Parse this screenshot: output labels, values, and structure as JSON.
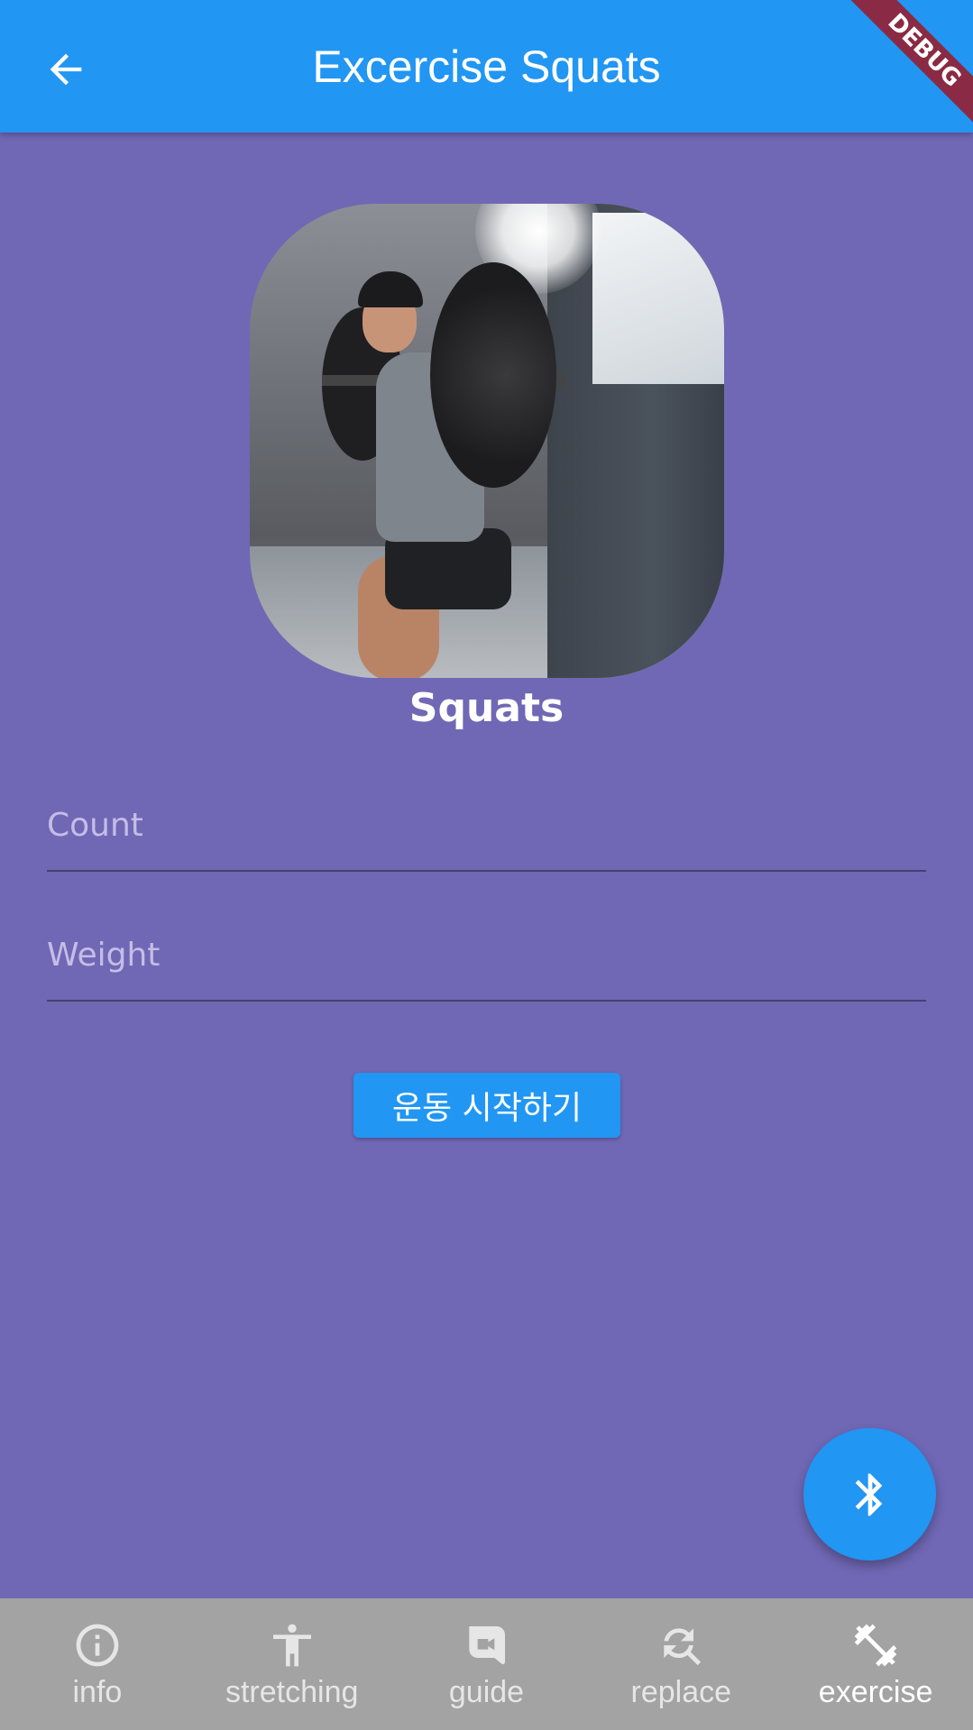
{
  "app_bar": {
    "title": "Excercise Squats",
    "back_icon": "arrow-left-icon",
    "background": "#2196f3"
  },
  "debug_banner": {
    "label": "DEBUG",
    "color": "#8a2a44"
  },
  "exercise": {
    "name": "Squats",
    "image_icon": "squat-photo"
  },
  "form": {
    "count_placeholder": "Count",
    "count_value": "",
    "weight_placeholder": "Weight",
    "weight_value": "",
    "start_label": "운동 시작하기"
  },
  "fab": {
    "icon": "bluetooth-icon",
    "color": "#2196f3"
  },
  "bottom_nav": {
    "selected": "exercise",
    "items": [
      {
        "label": "info",
        "icon": "info-icon"
      },
      {
        "label": "stretching",
        "icon": "accessibility-icon"
      },
      {
        "label": "guide",
        "icon": "video-icon"
      },
      {
        "label": "replace",
        "icon": "replace-search-icon"
      },
      {
        "label": "exercise",
        "icon": "dumbbell-icon"
      }
    ]
  },
  "colors": {
    "page_background": "#7068b5",
    "nav_background": "#a3a3a3",
    "underline": "#47406e"
  }
}
